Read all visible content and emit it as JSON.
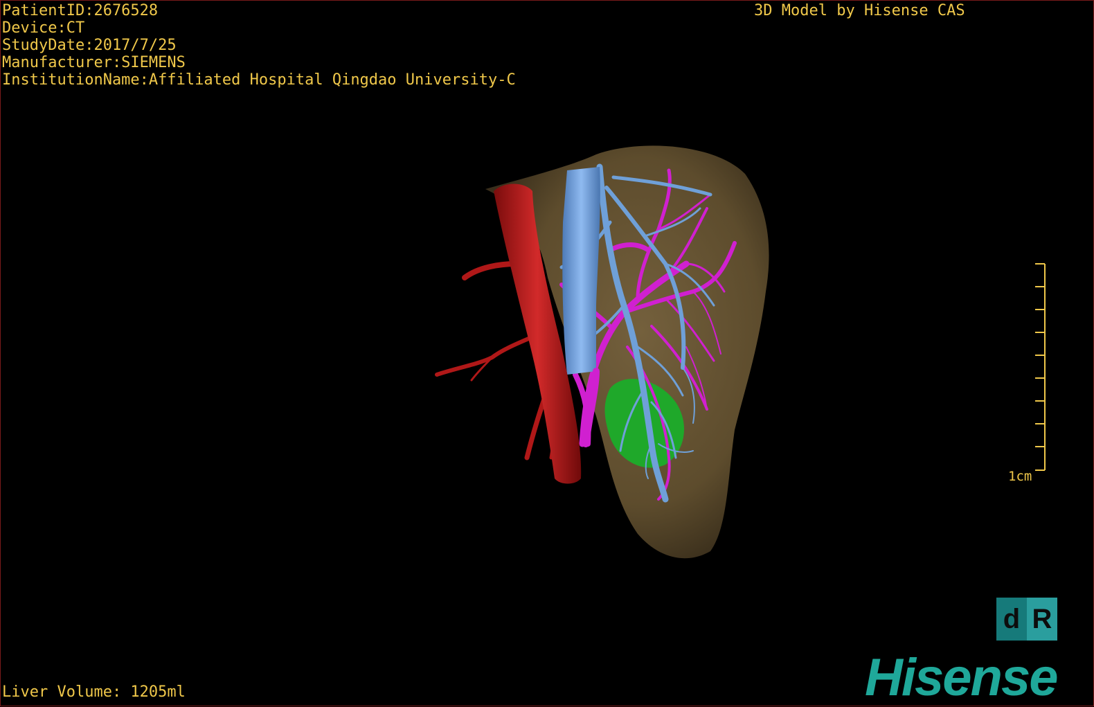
{
  "info": {
    "patient_id": "PatientID:2676528",
    "device": "Device:CT",
    "study_date": "StudyDate:2017/7/25",
    "manufacturer": "Manufacturer:SIEMENS",
    "institution": "InstitutionName:Affiliated Hospital Qingdao University-C"
  },
  "brand_caption": "3D Model by Hisense CAS",
  "liver_volume": "Liver Volume: 1205ml",
  "scale": {
    "label": "1cm"
  },
  "orientation": {
    "left": "d",
    "right": "R"
  },
  "logo": "Hisense",
  "colors": {
    "text": "#f0c84a",
    "liver": "#6e5a3a",
    "artery": "#b01818",
    "portal_vein": "#6fa0d8",
    "hepatic_vein": "#d020d0",
    "tumor": "#1fa82a",
    "logo": "#1fa89a"
  }
}
